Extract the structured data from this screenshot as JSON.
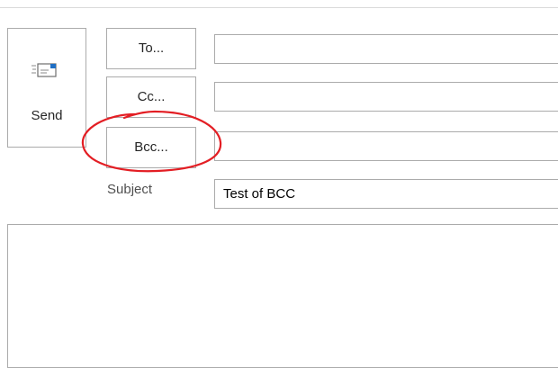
{
  "compose": {
    "send_label": "Send",
    "to_label": "To...",
    "cc_label": "Cc...",
    "bcc_label": "Bcc...",
    "subject_label": "Subject",
    "to_value": "",
    "cc_value": "",
    "bcc_value": "",
    "subject_value": "Test of BCC",
    "body_value": ""
  },
  "icons": {
    "send": "envelope-send-icon"
  },
  "colors": {
    "annotation": "#e31e24",
    "border": "#ababab",
    "send_icon_accent": "#1f6fc5"
  }
}
